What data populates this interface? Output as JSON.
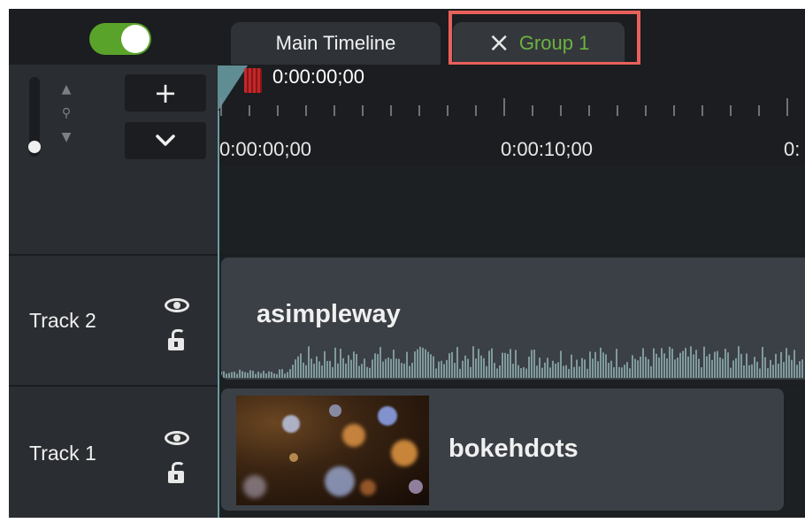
{
  "header": {
    "toggle_on": true,
    "tabs": [
      {
        "label": "Main Timeline",
        "active": false
      },
      {
        "label": "Group 1",
        "active": true,
        "closable": true
      }
    ],
    "close_glyph": "×"
  },
  "controls": {
    "add_glyph": "+",
    "collapse_glyph": "⌄",
    "zoom_icon": "magnifier-zoom-icon"
  },
  "ruler": {
    "playhead_time": "0:00:00;00",
    "labels": [
      "0:00:00;00",
      "0:00:10;00",
      "0:"
    ]
  },
  "tracks": [
    {
      "name": "Track 2",
      "clip": "asimpleway",
      "clip_type": "audio"
    },
    {
      "name": "Track 1",
      "clip": "bokehdots",
      "clip_type": "video"
    }
  ],
  "colors": {
    "accent_green": "#5aa32a",
    "group_tab_text": "#6db33f",
    "highlight": "#e8615a",
    "playhead": "#c0282a"
  }
}
